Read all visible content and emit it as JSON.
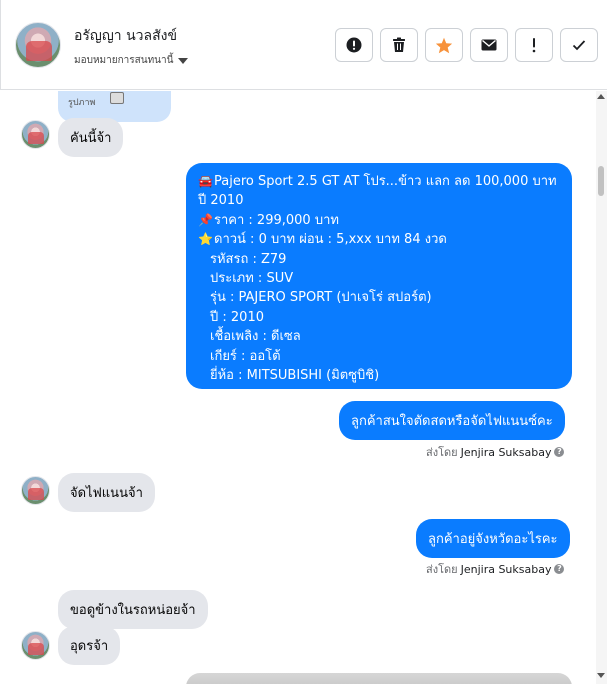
{
  "contact": {
    "name": "อรัญญา นวลสังข์",
    "assign_label": "มอบหมายการสนทนานี้"
  },
  "toolbar": {
    "buttons": [
      {
        "id": "spam",
        "icon": "exclamation-circle-icon"
      },
      {
        "id": "delete",
        "icon": "trash-icon"
      },
      {
        "id": "star",
        "icon": "star-icon",
        "color": "#f7923b"
      },
      {
        "id": "unread",
        "icon": "envelope-icon"
      },
      {
        "id": "follow-up",
        "icon": "exclamation-icon"
      },
      {
        "id": "done",
        "icon": "checkmark-icon"
      }
    ]
  },
  "colors": {
    "outgoing": "#0a7cff",
    "incoming": "#e4e6eb",
    "image_chip": "#cfe3fb"
  },
  "messages": {
    "image_chip_label": "รูปภาพ",
    "m1": "คันนี้จ้า",
    "listing": {
      "lines": [
        {
          "emoji": "🚘",
          "text": "Pajero Sport 2.5 GT AT โปร...ข้าว แลก ลด 100,000 บาท"
        },
        {
          "emoji": "",
          "text": "ปี 2010"
        },
        {
          "emoji": "📌",
          "text": "ราคา : 299,000 บาท"
        },
        {
          "emoji": "⭐",
          "text": "ดาวน์ : 0 บาท ผ่อน : 5,xxx บาท 84 งวด"
        },
        {
          "emoji": "",
          "text": "รหัสรถ : Z79"
        },
        {
          "emoji": "",
          "text": "ประเภท : SUV"
        },
        {
          "emoji": "",
          "text": "รุ่น : PAJERO SPORT (ปาเจโร่ สปอร์ต)"
        },
        {
          "emoji": "",
          "text": "ปี : 2010"
        },
        {
          "emoji": "",
          "text": "เชื้อเพลิง : ดีเซล"
        },
        {
          "emoji": "",
          "text": "เกียร์ : ออโต้"
        },
        {
          "emoji": "",
          "text": "ยี่ห้อ : MITSUBISHI (มิตซูบิชิ)"
        }
      ]
    },
    "m2": "ลูกค้าสนใจตัดสดหรือจัดไฟแนนซ์คะ",
    "sent_by_label": "ส่งโดย",
    "sent_by_name": "Jenjira Suksabay",
    "help": "?",
    "m3": "จัดไฟแนนจ้า",
    "m4": "ลูกค้าอยู่จังหวัดอะไรคะ",
    "m5": "ขอดูข้างในรถหน่อยจ้า",
    "m6": "อุดรจ้า"
  }
}
